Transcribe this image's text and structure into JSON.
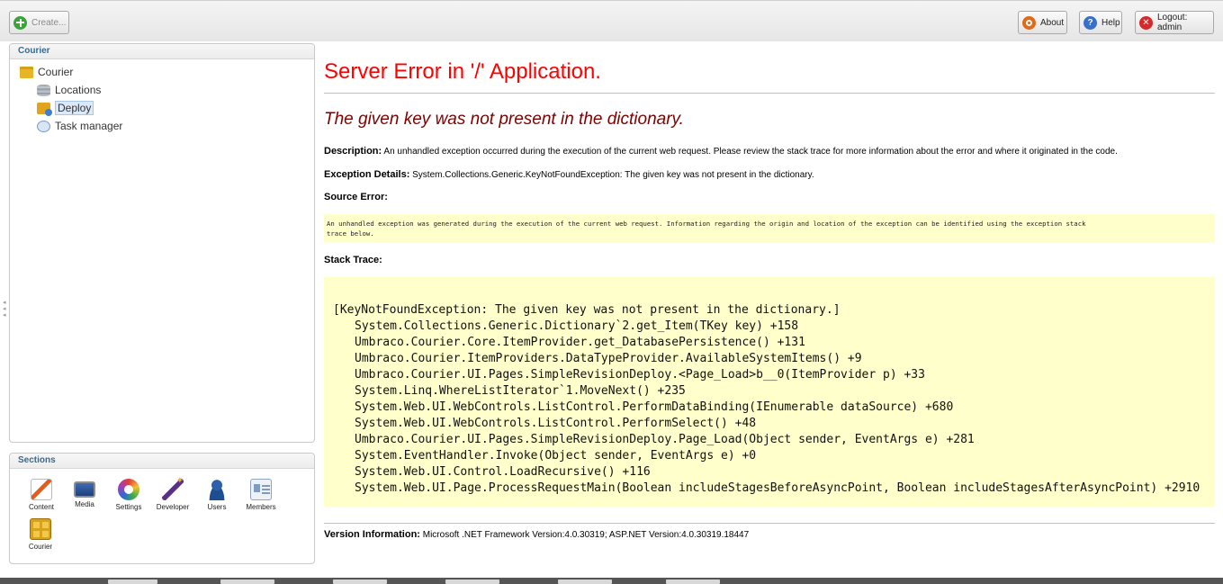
{
  "toolbar": {
    "create_label": "Create...",
    "about_label": "About",
    "help_label": "Help",
    "logout_label": "Logout: admin"
  },
  "tree": {
    "header": "Courier",
    "root": "Courier",
    "items": [
      {
        "label": "Locations",
        "icon": "database-icon"
      },
      {
        "label": "Deploy",
        "icon": "deploy-icon",
        "selected": true
      },
      {
        "label": "Task manager",
        "icon": "task-manager-icon"
      }
    ]
  },
  "sections": {
    "header": "Sections",
    "items": [
      {
        "label": "Content",
        "icon": "content-icon"
      },
      {
        "label": "Media",
        "icon": "media-icon"
      },
      {
        "label": "Settings",
        "icon": "settings-icon"
      },
      {
        "label": "Developer",
        "icon": "developer-icon"
      },
      {
        "label": "Users",
        "icon": "users-icon"
      },
      {
        "label": "Members",
        "icon": "members-icon"
      },
      {
        "label": "Courier",
        "icon": "courier-icon"
      }
    ]
  },
  "error": {
    "title": "Server Error in '/' Application.",
    "message": "The given key was not present in the dictionary.",
    "description_label": "Description:",
    "description": "An unhandled exception occurred during the execution of the current web request. Please review the stack trace for more information about the error and where it originated in the code.",
    "exception_label": "Exception Details:",
    "exception": "System.Collections.Generic.KeyNotFoundException: The given key was not present in the dictionary.",
    "source_error_label": "Source Error:",
    "source_error_line1": "An unhandled exception was generated during the execution of the current web request. Information regarding the origin and location of the exception can be identified using the exception stack",
    "source_error_line2": "trace below.",
    "stack_trace_label": "Stack Trace:",
    "stack_trace": [
      "[KeyNotFoundException: The given key was not present in the dictionary.]",
      "System.Collections.Generic.Dictionary`2.get_Item(TKey key) +158",
      "Umbraco.Courier.Core.ItemProvider.get_DatabasePersistence() +131",
      "Umbraco.Courier.ItemProviders.DataTypeProvider.AvailableSystemItems() +9",
      "Umbraco.Courier.UI.Pages.SimpleRevisionDeploy.<Page_Load>b__0(ItemProvider p) +33",
      "System.Linq.WhereListIterator`1.MoveNext() +235",
      "System.Web.UI.WebControls.ListControl.PerformDataBinding(IEnumerable dataSource) +680",
      "System.Web.UI.WebControls.ListControl.PerformSelect() +48",
      "Umbraco.Courier.UI.Pages.SimpleRevisionDeploy.Page_Load(Object sender, EventArgs e) +281",
      "System.EventHandler.Invoke(Object sender, EventArgs e) +0",
      "System.Web.UI.Control.LoadRecursive() +116",
      "System.Web.UI.Page.ProcessRequestMain(Boolean includeStagesBeforeAsyncPoint, Boolean includeStagesAfterAsyncPoint) +2910"
    ],
    "version_label": "Version Information:",
    "version": "Microsoft .NET Framework Version:4.0.30319; ASP.NET Version:4.0.30319.18447"
  }
}
